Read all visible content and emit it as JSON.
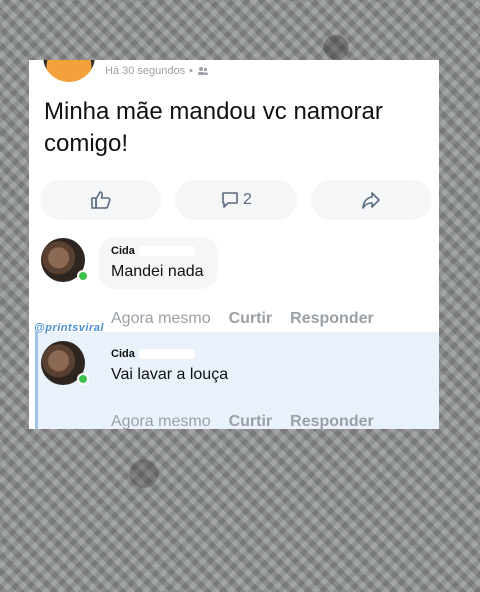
{
  "post": {
    "time": "Há 30 segundos",
    "separator": "•",
    "text": "Minha mãe mandou vc namorar comigo!",
    "comment_count": "2"
  },
  "watermark": "@printsviral",
  "comments": [
    {
      "name": "Cida",
      "text": "Mandei nada",
      "time": "Agora mesmo",
      "like": "Curtir",
      "reply": "Responder"
    },
    {
      "name": "Cida",
      "text": "Vai lavar a louça",
      "time": "Agora mesmo",
      "like": "Curtir",
      "reply": "Responder"
    }
  ],
  "colors": {
    "online": "#3cc24a",
    "reply_bg": "#e9f1fb",
    "watermark": "#4a8fd1"
  }
}
